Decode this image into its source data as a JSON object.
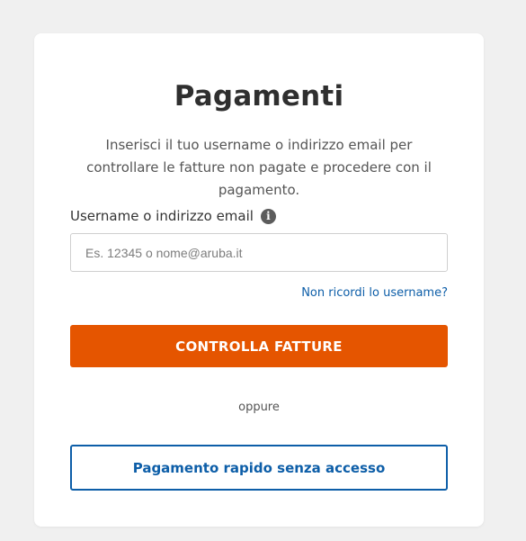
{
  "card": {
    "title": "Pagamenti",
    "intro": "Inserisci il tuo username o indirizzo email per controllare le fatture non pagate e procedere con il pagamento.",
    "field": {
      "label": "Username o indirizzo email",
      "info_icon": "info-icon",
      "info_glyph": "i",
      "placeholder": "Es. 12345 o nome@aruba.it",
      "value": ""
    },
    "forgot_link": "Non ricordi lo username?",
    "primary_button": "CONTROLLA FATTURE",
    "separator": "oppure",
    "secondary_button": "Pagamento rapido senza accesso"
  },
  "colors": {
    "background": "#f0f0f0",
    "card": "#ffffff",
    "primary": "#e55500",
    "link": "#0d5ea8",
    "title": "#2f2f2f",
    "body_text": "#555555"
  }
}
